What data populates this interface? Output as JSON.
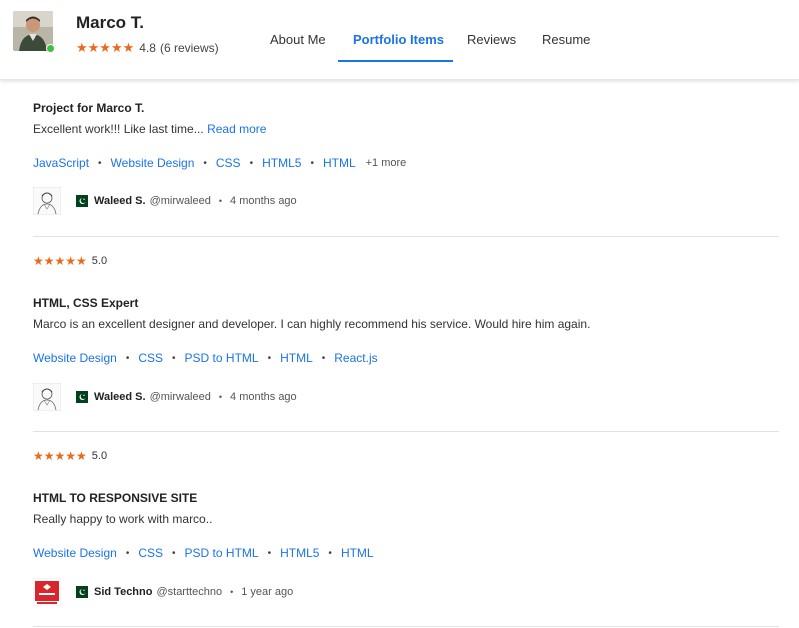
{
  "profile": {
    "name": "Marco T.",
    "rating": "4.8",
    "reviews": "(6 reviews)",
    "stars": "★★★★★",
    "online_color": "#3ec03e"
  },
  "tabs": [
    {
      "label": "About Me",
      "active": false
    },
    {
      "label": "Portfolio Items",
      "active": true
    },
    {
      "label": "Reviews",
      "active": false
    },
    {
      "label": "Resume",
      "active": false
    }
  ],
  "colors": {
    "link": "#1a73e8",
    "star": "#e86a1a"
  },
  "reviews": [
    {
      "title": "Project for Marco T.",
      "text": "Excellent work!!! Like last time... ",
      "read_more": "Read more",
      "tags": [
        "JavaScript",
        "Website Design",
        "CSS",
        "HTML5",
        "HTML"
      ],
      "more": "+1 more",
      "author": {
        "name": "Waleed S.",
        "handle": "@mirwaleed",
        "time": "4 months ago",
        "avatar_icon": "sketch-portrait-icon",
        "flag_icon": "pakistan-flag-icon"
      }
    },
    {
      "stars": "★★★★★",
      "rating": "5.0",
      "title": "HTML, CSS Expert",
      "text": "Marco is an excellent designer and developer. I can highly recommend his service. Would hire him again.",
      "tags": [
        "Website Design",
        "CSS",
        "PSD to HTML",
        "HTML",
        "React.js"
      ],
      "author": {
        "name": "Waleed S.",
        "handle": "@mirwaleed",
        "time": "4 months ago",
        "avatar_icon": "sketch-portrait-icon",
        "flag_icon": "pakistan-flag-icon"
      }
    },
    {
      "stars": "★★★★★",
      "rating": "5.0",
      "title": "HTML TO RESPONSIVE SITE",
      "text": "Really happy to work with marco..",
      "tags": [
        "Website Design",
        "CSS",
        "PSD to HTML",
        "HTML5",
        "HTML"
      ],
      "author": {
        "name": "Sid Techno",
        "handle": "@starttechno",
        "time": "1 year ago",
        "avatar_icon": "sid-techno-logo-icon",
        "flag_icon": "pakistan-flag-icon"
      }
    }
  ]
}
